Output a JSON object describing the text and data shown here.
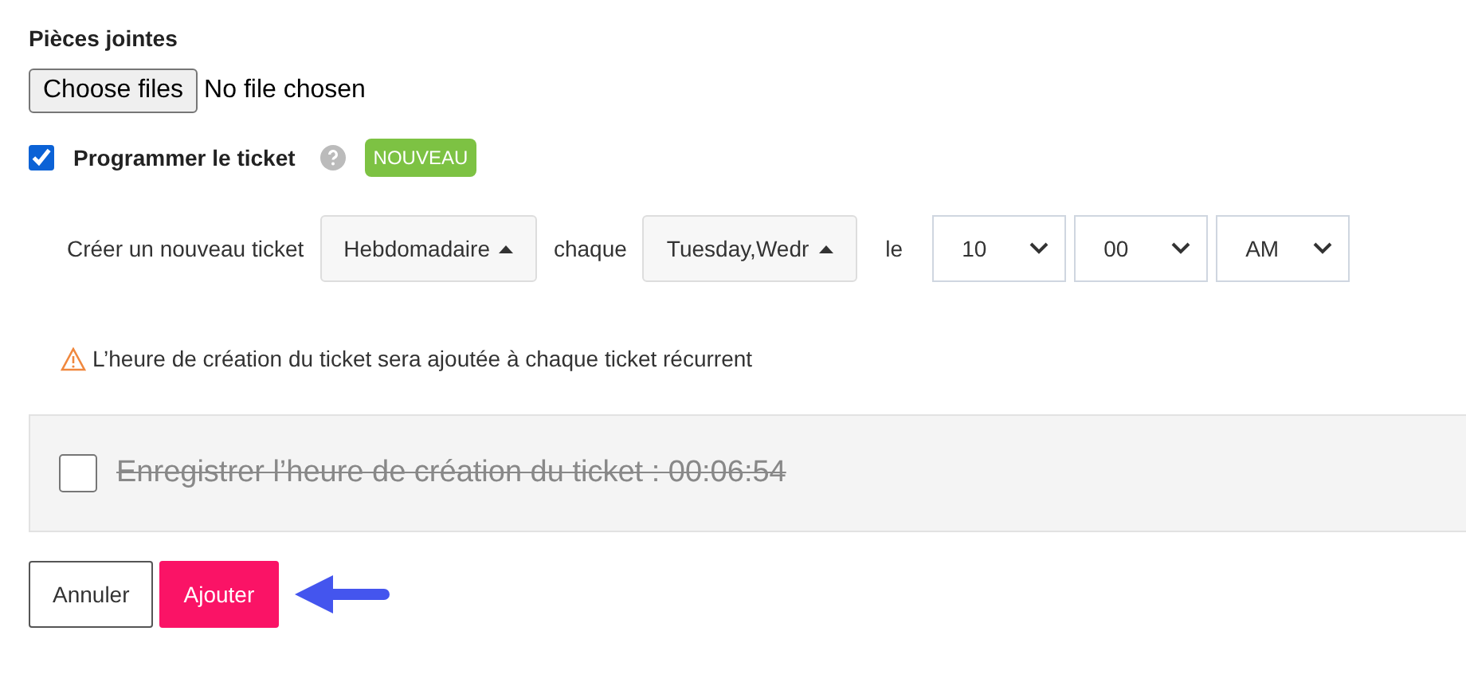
{
  "attachments": {
    "label": "Pièces jointes",
    "button": "Choose files",
    "status": "No file chosen"
  },
  "schedule": {
    "label": "Programmer le ticket",
    "checked": true,
    "badge": "NOUVEAU"
  },
  "recurrence": {
    "prefix": "Créer un nouveau ticket",
    "frequency": "Hebdomadaire",
    "every_label": "chaque",
    "days": "Tuesday,Wedr",
    "at_label": "le",
    "hour": "10",
    "minute": "00",
    "period": "AM"
  },
  "warning": "L’heure de création du ticket sera ajoutée à chaque ticket récurrent",
  "record_time": {
    "label": "Enregistrer l’heure de création du ticket : 00:06:54",
    "checked": false
  },
  "buttons": [
    {
      "label": "Annuler",
      "kind": "secondary"
    },
    {
      "label": "Ajouter",
      "kind": "primary"
    }
  ]
}
